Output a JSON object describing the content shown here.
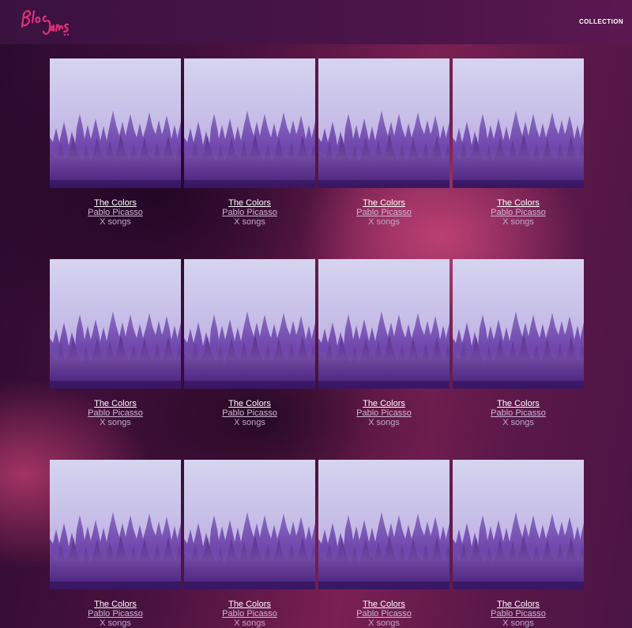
{
  "header": {
    "logo_text": "Bloc Jams",
    "nav": {
      "collection_label": "COLLECTION"
    }
  },
  "colors": {
    "logo": "#e0307a",
    "sky_top": "#dcd8f2",
    "forest": "#4a1a8a"
  },
  "albums": [
    {
      "title": "The Colors",
      "artist": "Pablo Picasso",
      "songs": "X songs"
    },
    {
      "title": "The Colors",
      "artist": "Pablo Picasso",
      "songs": "X songs"
    },
    {
      "title": "The Colors",
      "artist": "Pablo Picasso",
      "songs": "X songs"
    },
    {
      "title": "The Colors",
      "artist": "Pablo Picasso",
      "songs": "X songs"
    },
    {
      "title": "The Colors",
      "artist": "Pablo Picasso",
      "songs": "X songs"
    },
    {
      "title": "The Colors",
      "artist": "Pablo Picasso",
      "songs": "X songs"
    },
    {
      "title": "The Colors",
      "artist": "Pablo Picasso",
      "songs": "X songs"
    },
    {
      "title": "The Colors",
      "artist": "Pablo Picasso",
      "songs": "X songs"
    },
    {
      "title": "The Colors",
      "artist": "Pablo Picasso",
      "songs": "X songs"
    },
    {
      "title": "The Colors",
      "artist": "Pablo Picasso",
      "songs": "X songs"
    },
    {
      "title": "The Colors",
      "artist": "Pablo Picasso",
      "songs": "X songs"
    },
    {
      "title": "The Colors",
      "artist": "Pablo Picasso",
      "songs": "X songs"
    }
  ]
}
